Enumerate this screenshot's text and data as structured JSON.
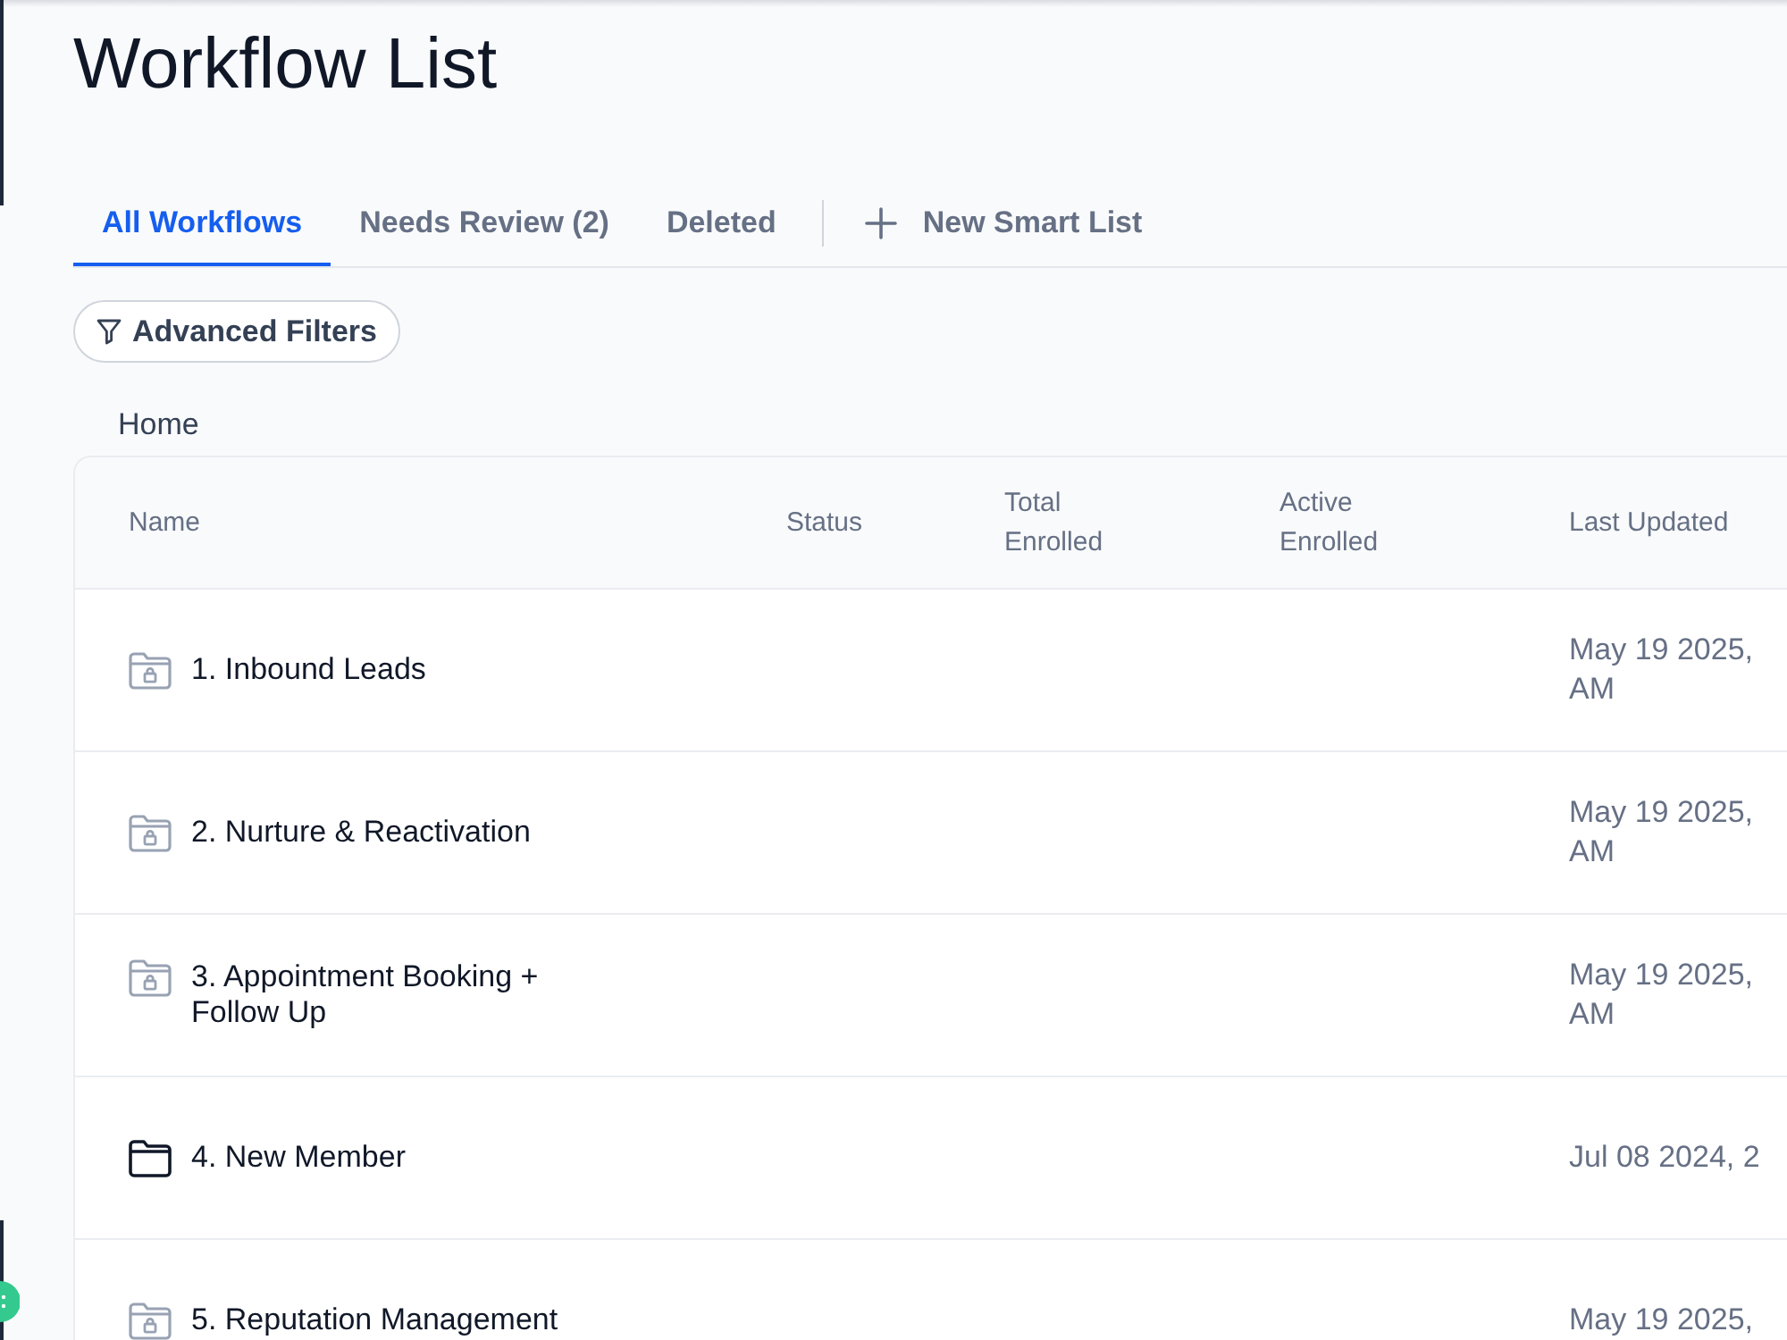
{
  "page": {
    "title": "Workflow List"
  },
  "tabs": [
    {
      "label": "All Workflows",
      "selected": true
    },
    {
      "label": "Needs Review (2)",
      "selected": false
    },
    {
      "label": "Deleted",
      "selected": false
    }
  ],
  "new_smart_list_button": {
    "label": "New Smart List"
  },
  "filter_button": {
    "label": "Advanced Filters"
  },
  "breadcrumb": [
    "Home"
  ],
  "table": {
    "columns": [
      "Name",
      "Status",
      "Total Enrolled",
      "Active Enrolled",
      "Last Updated"
    ],
    "rows": [
      {
        "kind": "locked_folder",
        "name": "1. Inbound Leads",
        "last_updated": "May 19 2025,\nAM"
      },
      {
        "kind": "locked_folder",
        "name": "2. Nurture & Reactivation",
        "last_updated": "May 19 2025,\nAM"
      },
      {
        "kind": "locked_folder",
        "name": "3. Appointment Booking + Follow Up",
        "last_updated": "May 19 2025,\nAM"
      },
      {
        "kind": "folder",
        "name": "4. New Member",
        "last_updated": "Jul 08 2024, 2"
      },
      {
        "kind": "locked_folder",
        "name": "5. Reputation Management",
        "last_updated": "May 19 2025,"
      }
    ]
  }
}
